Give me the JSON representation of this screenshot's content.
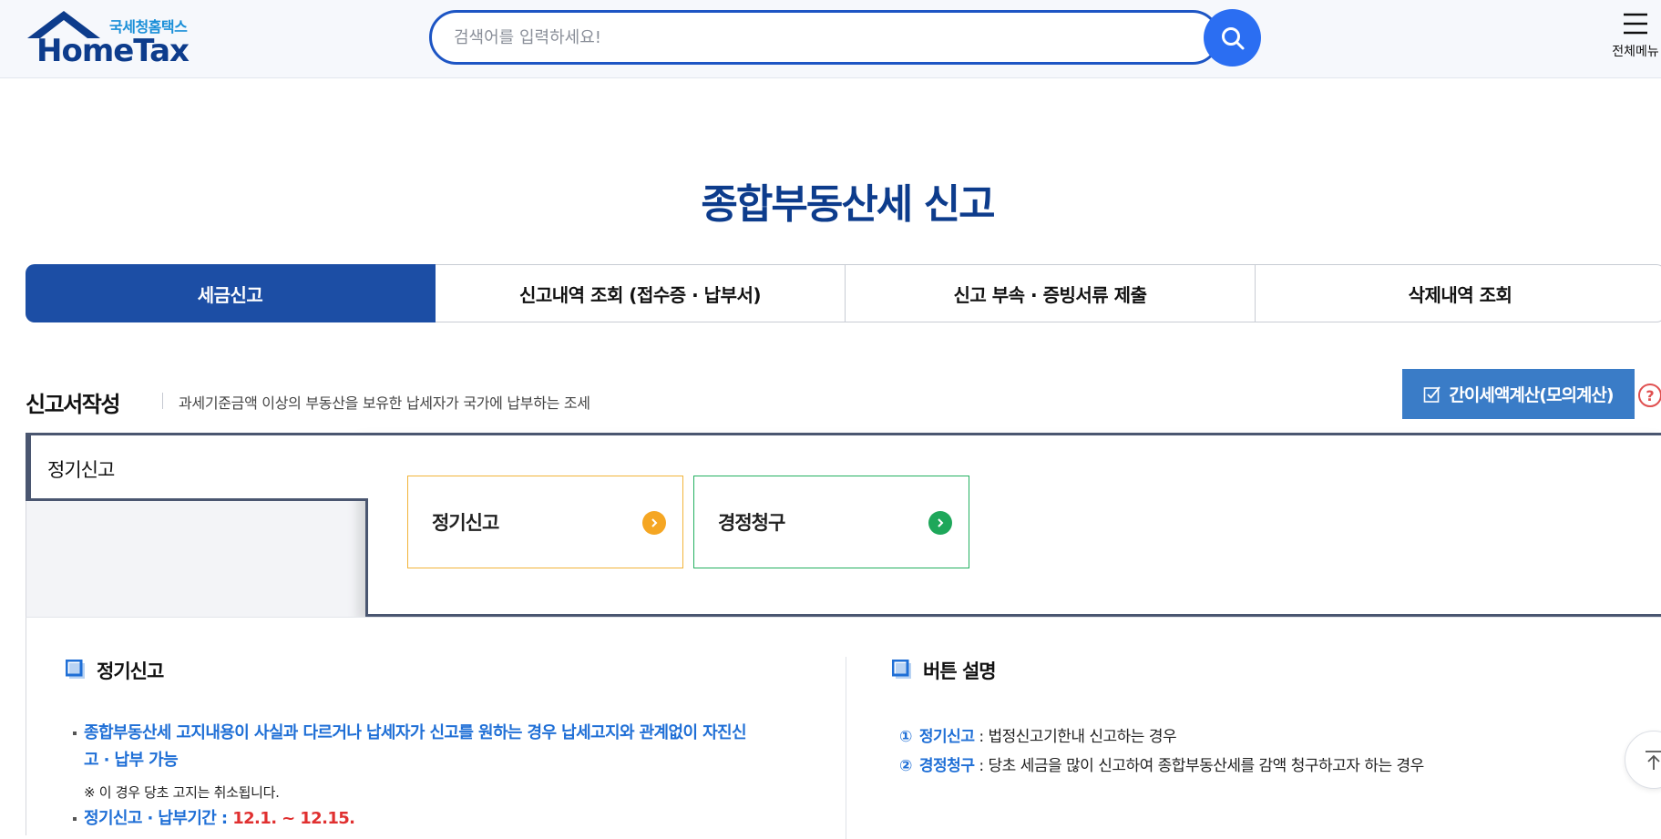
{
  "header": {
    "logo_sub": "국세청홈택스",
    "logo_main": "HomeTax",
    "search_placeholder": "검색어를 입력하세요!",
    "allmenu_label": "전체메뉴"
  },
  "page": {
    "title": "종합부동산세 신고"
  },
  "tabs": [
    {
      "label": "세금신고",
      "active": true
    },
    {
      "label": "신고내역 조회 (접수증 · 납부서)",
      "active": false
    },
    {
      "label": "신고 부속 · 증빙서류 제출",
      "active": false
    },
    {
      "label": "삭제내역 조회",
      "active": false
    }
  ],
  "section": {
    "title": "신고서작성",
    "description": "과세기준금액 이상의 부동산을 보유한 납세자가 국가에 납부하는 조세",
    "calc_button": "간이세액계산(모의계산)",
    "help": "?"
  },
  "panel": {
    "left_label": "정기신고",
    "choices": [
      {
        "label": "정기신고",
        "color": "#f5a623"
      },
      {
        "label": "경정청구",
        "color": "#1ea75a"
      }
    ]
  },
  "info_left": {
    "heading": "정기신고",
    "bullet1_line1": "종합부동산세 고지내용이 사실과 다르거나 납세자가 신고를 원하는 경우 납세고지와 관계없이 자진신",
    "bullet1_line2": "고 · 납부 가능",
    "note": "※ 이 경우 당초 고지는 취소됩니다.",
    "bullet2_label": "정기신고 · 납부기간 : ",
    "bullet2_value": "12.1. ~ 12.15."
  },
  "info_right": {
    "heading": "버튼 설명",
    "items": [
      {
        "num": "①",
        "term": "정기신고",
        "desc": " : 법정신고기한내 신고하는 경우"
      },
      {
        "num": "②",
        "term": "경정청구",
        "desc": " : 당초 세금을 많이 신고하여 종합부동산세를 감액 청구하고자 하는 경우"
      }
    ]
  },
  "colors": {
    "brand_navy": "#0d3c8c",
    "tab_active": "#1c4ea5",
    "search_blue": "#2b6ef2",
    "link_blue": "#1f6fd6",
    "accent_red": "#e03030"
  }
}
